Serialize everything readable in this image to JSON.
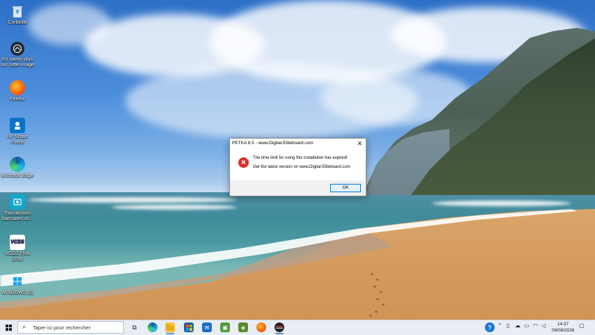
{
  "desktop": {
    "icons": [
      {
        "label": "Corbeille",
        "icon": "recycle-bin-icon"
      },
      {
        "label": "En savoir plus sur cette image",
        "icon": "camera-info-icon"
      },
      {
        "label": "Firefox",
        "icon": "firefox-icon"
      },
      {
        "label": "HP Smart Friend",
        "icon": "hp-smart-friend-icon"
      },
      {
        "label": "Microsoft Edge",
        "icon": "edge-icon"
      },
      {
        "label": "Transactions bancaires et...",
        "icon": "bank-transactions-icon"
      },
      {
        "label": "VCDS FRA 2018",
        "icon": "vcds-icon"
      },
      {
        "label": "WINDOWS (2)",
        "icon": "windows-folder-icon"
      }
    ]
  },
  "dialog": {
    "title": "PETKA 8.5 - www.Digital-Eliteboard.com",
    "close_glyph": "✕",
    "message_line1": "The time limit for using this installation has expired!",
    "message_line2": "Get the latest version on www.Digital-Eliteboard.com",
    "ok_label": "OK",
    "icon": "error-icon"
  },
  "taskbar": {
    "search_placeholder": "Taper ici pour rechercher",
    "apps": [
      "task-view-icon",
      "edge-icon",
      "file-explorer-icon",
      "store-icon",
      "mail-icon",
      "green-app-icon",
      "green-app-2-icon",
      "firefox-icon",
      "petka-icon"
    ],
    "time": "14:37",
    "date": "09/08/2026"
  },
  "colors": {
    "error_red": "#d9312b",
    "ok_border": "#0078d7",
    "taskbar_bg": "#e9eef5"
  }
}
